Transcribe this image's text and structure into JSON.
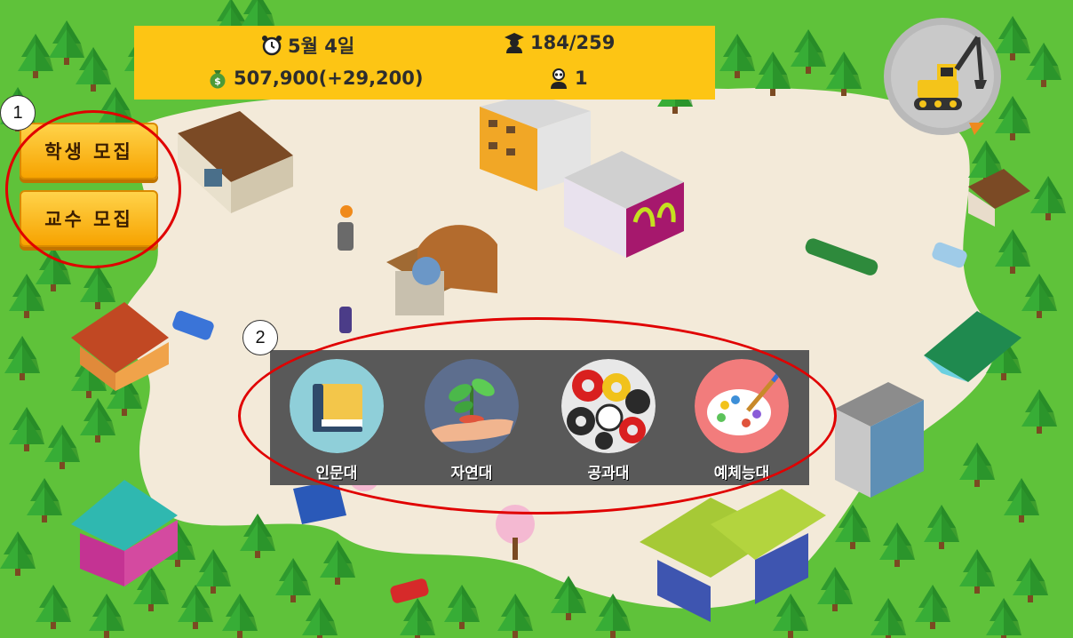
{
  "hud": {
    "date": "5월 4일",
    "students": "184/259",
    "money": "507,900(+29,200)",
    "professors": "1"
  },
  "side_buttons": {
    "recruit_students": "학생 모집",
    "recruit_professors": "교수 모집"
  },
  "annotations": {
    "marker_1": "1",
    "marker_2": "2",
    "ring_color": "#e00000"
  },
  "colleges": [
    {
      "label": "인문대",
      "icon": "book-icon"
    },
    {
      "label": "자연대",
      "icon": "seedling-icon"
    },
    {
      "label": "공과대",
      "icon": "gears-icon"
    },
    {
      "label": "예체능대",
      "icon": "paint-palette-icon"
    }
  ],
  "build_button": {
    "icon": "excavator-icon"
  },
  "colors": {
    "grass": "#5fc23a",
    "path": "#f3ead9",
    "hud_bg": "#fdc514",
    "panel_bg": "#595959",
    "button": "#f7a300"
  }
}
